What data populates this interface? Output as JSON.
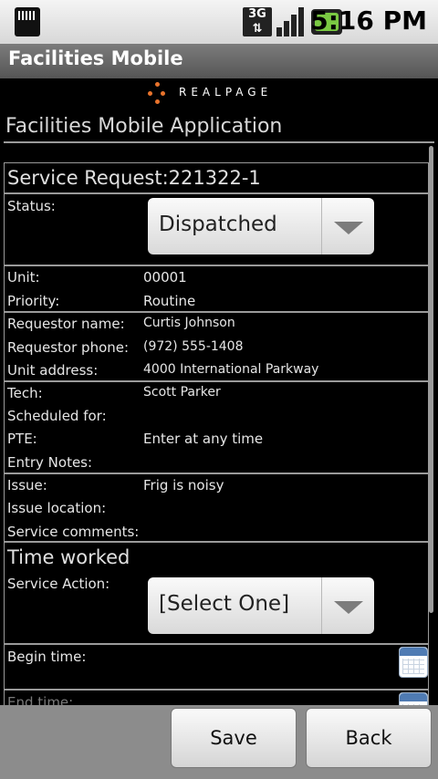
{
  "status_bar": {
    "time": "5:16 PM",
    "network": "3G"
  },
  "app_bar": {
    "title": "Facilities Mobile"
  },
  "logo": {
    "text": "REALPAGE"
  },
  "header": {
    "title": "Facilities Mobile Application"
  },
  "service_request": {
    "title": "Service Request:221322-1",
    "status_label": "Status:",
    "status_value": "Dispatched",
    "fields": [
      {
        "label": "Unit:",
        "value": "00001"
      },
      {
        "label": "Priority:",
        "value": "Routine"
      },
      {
        "label": "Requestor name:",
        "value": "Curtis Johnson"
      },
      {
        "label": "Requestor phone:",
        "value": "(972) 555-1408"
      },
      {
        "label": "Unit address:",
        "value": "4000 International Parkway"
      },
      {
        "label": "Tech:",
        "value": "Scott Parker"
      },
      {
        "label": "Scheduled for:",
        "value": ""
      },
      {
        "label": "PTE:",
        "value": "Enter at any time"
      },
      {
        "label": "Entry Notes:",
        "value": ""
      },
      {
        "label": "Issue:",
        "value": "Frig is noisy"
      },
      {
        "label": "Issue location:",
        "value": ""
      },
      {
        "label": "Service comments:",
        "value": ""
      }
    ]
  },
  "time_worked": {
    "title": "Time worked",
    "service_action_label": "Service Action:",
    "service_action_value": "[Select One]",
    "begin_time_label": "Begin time:",
    "end_time_label": "End time:"
  },
  "buttons": {
    "save": "Save",
    "back": "Back"
  },
  "colors": {
    "accent": "#e8732c",
    "background": "#000000",
    "divider": "#9a9a9a"
  }
}
